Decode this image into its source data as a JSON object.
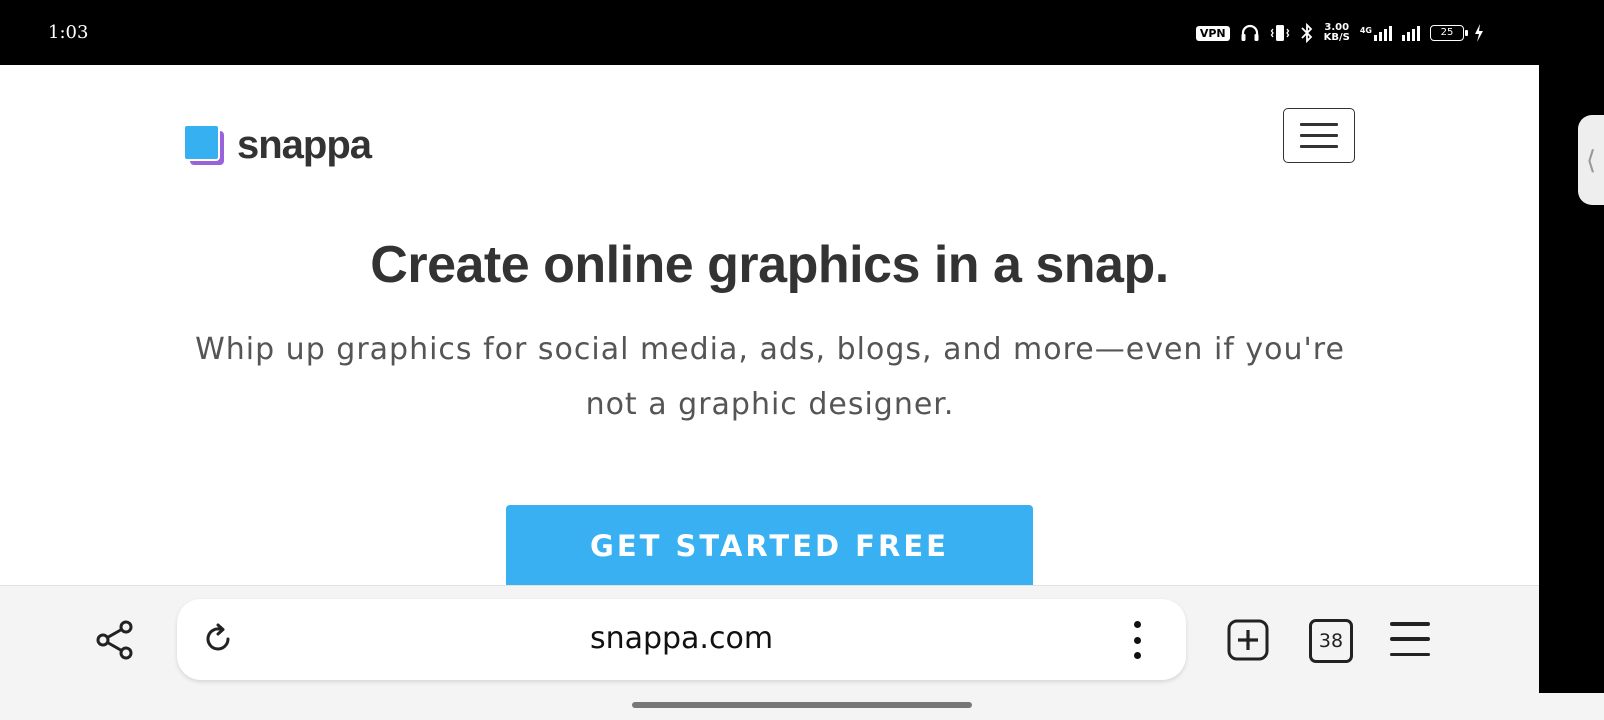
{
  "status_bar": {
    "time": "1:03",
    "vpn": "VPN",
    "speed_value": "3.00",
    "speed_unit": "KB/S",
    "network": "4G",
    "battery": "25"
  },
  "site": {
    "logo_text": "snappa",
    "hero_title": "Create online graphics in a snap.",
    "hero_subtitle": "Whip up graphics for social media, ads, blogs, and more—even if you're not a graphic designer.",
    "cta_label": "GET STARTED FREE"
  },
  "browser": {
    "url": "snappa.com",
    "tab_count": "38"
  },
  "colors": {
    "brand_blue": "#38b0f2",
    "brand_purple": "#9a63dc",
    "text_dark": "#333333"
  },
  "icons": [
    "share-icon",
    "reload-icon",
    "more-vert-icon",
    "new-tab-icon",
    "tabs-icon",
    "menu-icon",
    "hamburger-icon",
    "headphones-icon",
    "vibrate-icon",
    "bluetooth-icon",
    "signal-icon",
    "battery-icon",
    "charging-icon"
  ]
}
